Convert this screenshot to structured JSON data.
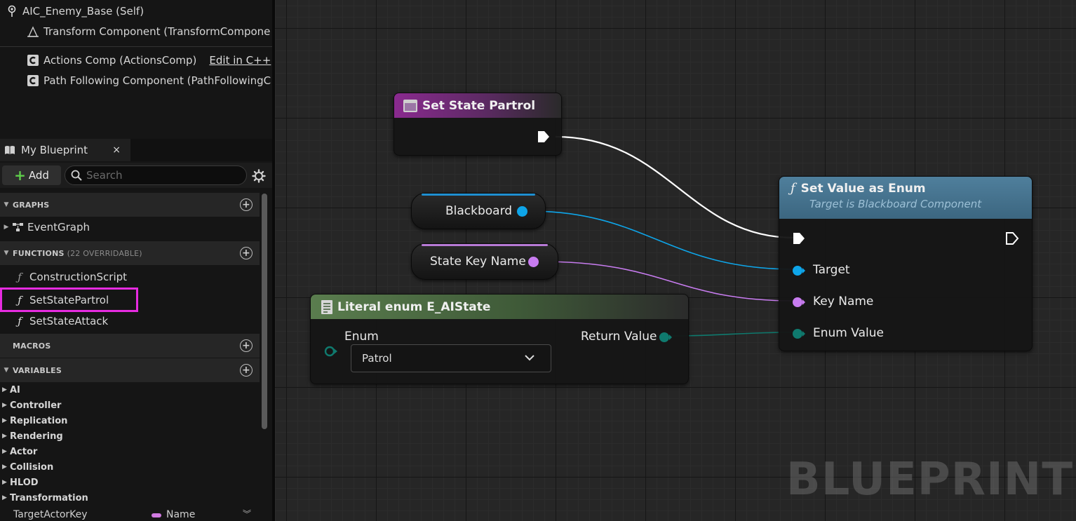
{
  "components": {
    "root": "AIC_Enemy_Base (Self)",
    "transform": "Transform Component (TransformCompone",
    "actions": "Actions Comp (ActionsComp)",
    "edit_cpp": "Edit in C++",
    "path_following": "Path Following Component (PathFollowingC"
  },
  "my_blueprint": {
    "tab_label": "My Blueprint",
    "close_glyph": "×",
    "add_label": "Add",
    "search_placeholder": "Search",
    "sections": {
      "graphs": "GRAPHS",
      "functions": "FUNCTIONS",
      "functions_sub": "(22 OVERRIDABLE)",
      "macros": "MACROS",
      "variables": "VARIABLES"
    },
    "graphs": [
      "EventGraph"
    ],
    "functions": [
      "ConstructionScript",
      "SetStatePartrol",
      "SetStateAttack"
    ],
    "variable_categories": [
      "AI",
      "Controller",
      "Replication",
      "Rendering",
      "Actor",
      "Collision",
      "HLOD",
      "Transformation"
    ],
    "variable": {
      "name": "TargetActorKey",
      "type": "Name"
    },
    "selected_function": "SetStatePartrol"
  },
  "graph": {
    "nodes": {
      "set_state_partrol": {
        "title": "Set State Partrol"
      },
      "blackboard": {
        "label": "Blackboard"
      },
      "state_key_name": {
        "label": "State Key Name"
      },
      "literal_enum": {
        "title": "Literal enum E_AIState",
        "enum_label": "Enum",
        "enum_value": "Patrol",
        "return_label": "Return Value"
      },
      "set_value_as_enum": {
        "title": "Set Value as Enum",
        "subtitle": "Target is Blackboard Component",
        "pins": [
          "Target",
          "Key Name",
          "Enum Value"
        ]
      }
    },
    "watermark": "BLUEPRINT",
    "colors": {
      "exec": "#ffffff",
      "object": "#0ea5e9",
      "name": "#c87cf0",
      "enum": "#0f7a6e",
      "func_header": "#4e7a93",
      "event_header": "#8a2a8f",
      "pure_header": "#5a7d4e",
      "selection": "#e62be0"
    }
  }
}
